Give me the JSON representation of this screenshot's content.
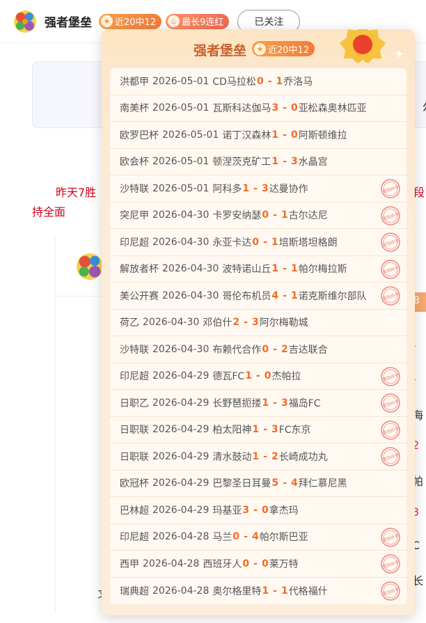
{
  "header": {
    "name": "强者堡垒",
    "badge_hits": "近20中12",
    "badge_streak": "最长9连红",
    "follow_label": "已关注"
  },
  "background": {
    "card_text": "尔",
    "text_line1": "昨天7胜",
    "text_line1_right": "段",
    "text_line2": "持全面",
    "right_items": [
      "-",
      "-",
      "海",
      "2",
      "帕",
      "3",
      "C",
      "长"
    ],
    "tag_text": "8",
    "bottom_text": "文"
  },
  "popup": {
    "title": "强者堡垒",
    "badge": "近20中12",
    "stamp_text": "预测命中",
    "matches": [
      {
        "league": "洪都甲",
        "date": "2026-05-01",
        "home": "CD马拉松",
        "hs": "0",
        "as": "1",
        "away": "乔洛马",
        "hit": false
      },
      {
        "league": "南美杯",
        "date": "2026-05-01",
        "home": "瓦斯科达伽马",
        "hs": "3",
        "as": "0",
        "away": "亚松森奥林匹亚",
        "hit": false
      },
      {
        "league": "欧罗巴杯",
        "date": "2026-05-01",
        "home": "诺丁汉森林",
        "hs": "1",
        "as": "0",
        "away": "阿斯顿维拉",
        "hit": false
      },
      {
        "league": "欧会杯",
        "date": "2026-05-01",
        "home": "顿涅茨克矿工",
        "hs": "1",
        "as": "3",
        "away": "水晶宫",
        "hit": false
      },
      {
        "league": "沙特联",
        "date": "2026-05-01",
        "home": "阿科多",
        "hs": "1",
        "as": "3",
        "away": "达曼协作",
        "hit": true
      },
      {
        "league": "突尼甲",
        "date": "2026-04-30",
        "home": "卡罗安纳瑟",
        "hs": "0",
        "as": "1",
        "away": "古尔达尼",
        "hit": true
      },
      {
        "league": "印尼超",
        "date": "2026-04-30",
        "home": "永亚卡达",
        "hs": "0",
        "as": "1",
        "away": "培斯塔坦格朗",
        "hit": true
      },
      {
        "league": "解放者杯",
        "date": "2026-04-30",
        "home": "波特诺山丘",
        "hs": "1",
        "as": "1",
        "away": "帕尔梅拉斯",
        "hit": true
      },
      {
        "league": "美公开赛",
        "date": "2026-04-30",
        "home": "哥伦布机员",
        "hs": "4",
        "as": "1",
        "away": "诺克斯维尔部队",
        "hit": true
      },
      {
        "league": "荷乙",
        "date": "2026-04-30",
        "home": "邓伯什",
        "hs": "2",
        "as": "3",
        "away": "阿尔梅勒城",
        "hit": false
      },
      {
        "league": "沙特联",
        "date": "2026-04-30",
        "home": "布赖代合作",
        "hs": "0",
        "as": "2",
        "away": "吉达联合",
        "hit": false
      },
      {
        "league": "印尼超",
        "date": "2026-04-29",
        "home": "德瓦FC",
        "hs": "1",
        "as": "0",
        "away": "杰帕拉",
        "hit": true
      },
      {
        "league": "日职乙",
        "date": "2026-04-29",
        "home": "长野琶扼搂",
        "hs": "1",
        "as": "3",
        "away": "福岛FC",
        "hit": true
      },
      {
        "league": "日职联",
        "date": "2026-04-29",
        "home": "柏太阳神",
        "hs": "1",
        "as": "3",
        "away": "FC东京",
        "hit": true
      },
      {
        "league": "日职联",
        "date": "2026-04-29",
        "home": "清水鼓动",
        "hs": "1",
        "as": "2",
        "away": "长崎成功丸",
        "hit": true
      },
      {
        "league": "欧冠杯",
        "date": "2026-04-29",
        "home": "巴黎圣日耳曼",
        "hs": "5",
        "as": "4",
        "away": "拜仁慕尼黑",
        "hit": false
      },
      {
        "league": "巴林超",
        "date": "2026-04-29",
        "home": "玛基亚",
        "hs": "3",
        "as": "0",
        "away": "拿杰玛",
        "hit": false
      },
      {
        "league": "印尼超",
        "date": "2026-04-28",
        "home": "马兰",
        "hs": "0",
        "as": "4",
        "away": "帕尔斯巴亚",
        "hit": true
      },
      {
        "league": "西甲",
        "date": "2026-04-28",
        "home": "西班牙人",
        "hs": "0",
        "as": "0",
        "away": "莱万特",
        "hit": true
      },
      {
        "league": "瑞典超",
        "date": "2026-04-28",
        "home": "奥尔格里特",
        "hs": "1",
        "as": "1",
        "away": "代格福什",
        "hit": true
      }
    ]
  }
}
